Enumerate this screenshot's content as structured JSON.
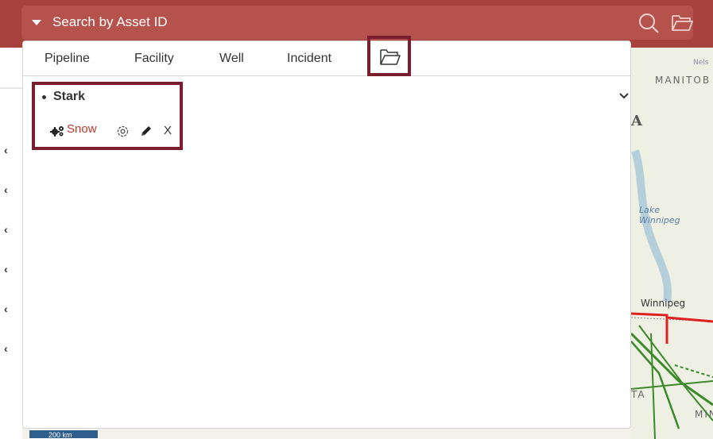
{
  "search": {
    "label": "Search by Asset ID"
  },
  "tabs": [
    {
      "label": "Pipeline"
    },
    {
      "label": "Facility"
    },
    {
      "label": "Well"
    },
    {
      "label": "Incident"
    }
  ],
  "saved_item": {
    "name": "Stark",
    "layer_label": "Snow",
    "close_label": "X"
  },
  "map": {
    "labels": {
      "nelson": "Nels",
      "manitoba": "MANITOB",
      "region_a": "A",
      "lake": "Lake\nWinnipeg",
      "winnipeg": "Winnipeg",
      "ta": "TA",
      "min": "MIN"
    },
    "scale": "200 km"
  },
  "colors": {
    "brand": "#a6423b",
    "highlight": "#7a1d2e",
    "link": "#c0392b"
  }
}
